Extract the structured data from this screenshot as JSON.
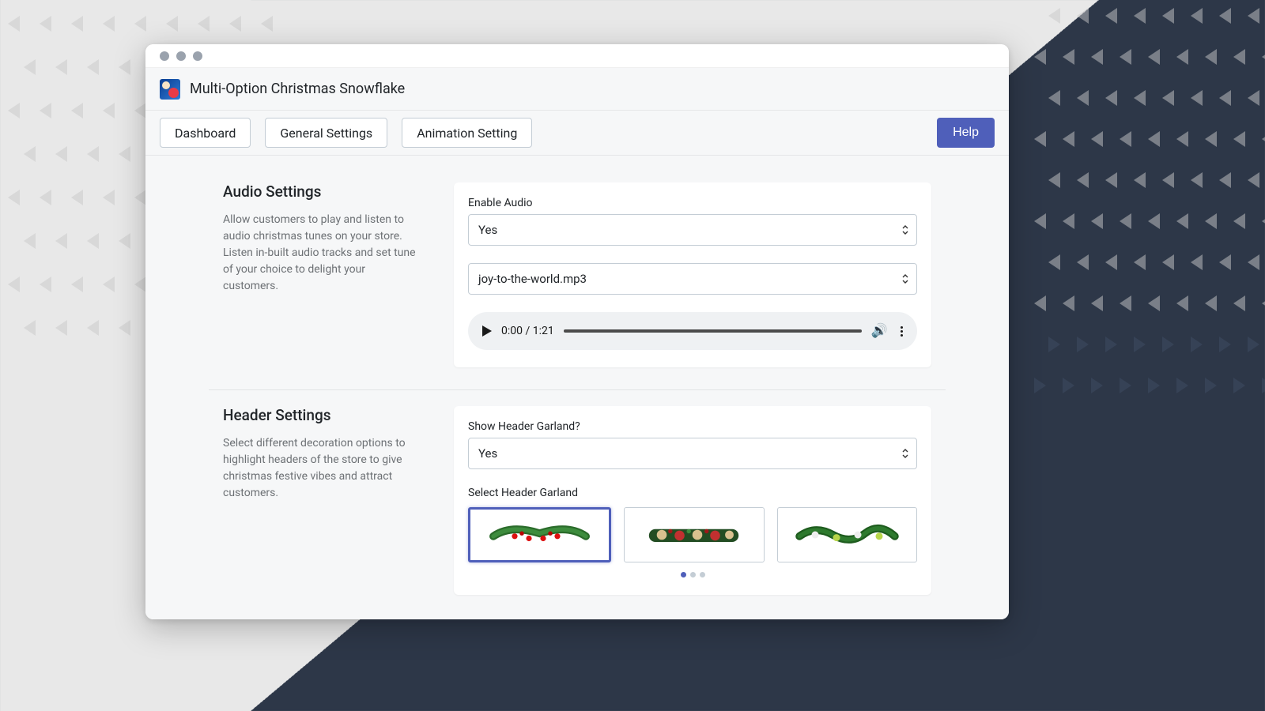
{
  "app": {
    "title": "Multi-Option Christmas Snowflake"
  },
  "nav": {
    "dashboard": "Dashboard",
    "general": "General Settings",
    "animation": "Animation Setting",
    "help": "Help"
  },
  "audio": {
    "title": "Audio Settings",
    "description": "Allow customers to play and listen to audio christmas tunes on your store. Listen in-built audio tracks and set tune of your choice to delight your customers.",
    "enable_label": "Enable Audio",
    "enable_value": "Yes",
    "track_value": "joy-to-the-world.mp3",
    "player": {
      "current_time": "0:00",
      "duration": "1:21"
    }
  },
  "header_section": {
    "title": "Header Settings",
    "description": "Select different decoration options to highlight headers of the store to give christmas festive vibes and attract customers.",
    "show_label": "Show Header Garland?",
    "show_value": "Yes",
    "select_garland_label": "Select Header Garland",
    "pagination": {
      "active": 0,
      "total": 3
    }
  }
}
